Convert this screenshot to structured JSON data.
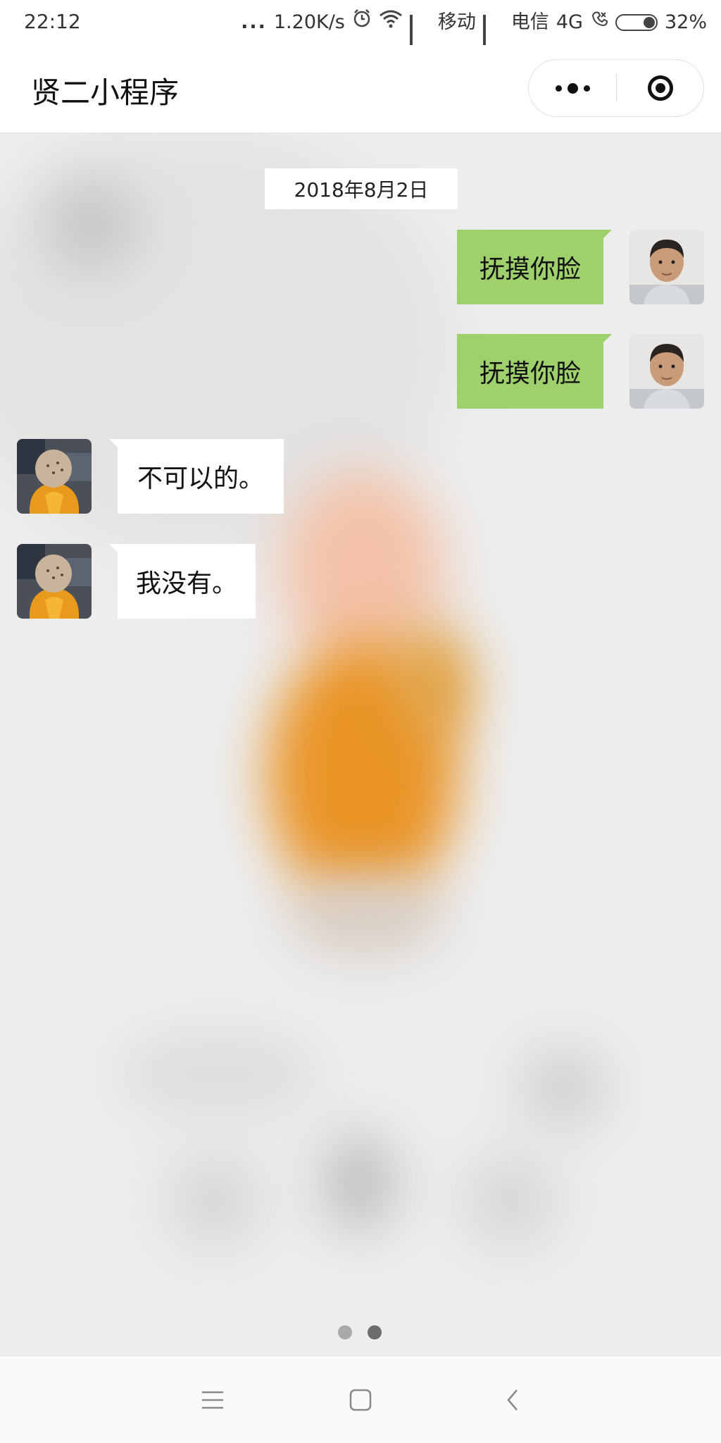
{
  "status_bar": {
    "time": "22:12",
    "more_dots": "...",
    "speed": "1.20K/s",
    "carrier1": "移动",
    "carrier2": "电信",
    "network": "4G",
    "battery": "32%"
  },
  "nav": {
    "title": "贤二小程序"
  },
  "chat": {
    "date": "2018年8月2日",
    "messages": [
      {
        "side": "right",
        "text": "抚摸你脸"
      },
      {
        "side": "right",
        "text": "抚摸你脸"
      },
      {
        "side": "left",
        "text": "不可以的。"
      },
      {
        "side": "left",
        "text": "我没有。"
      }
    ]
  },
  "pager": {
    "count": 2,
    "active": 1
  },
  "colors": {
    "bubble_user": "#9ed06c",
    "bubble_bot": "#ffffff",
    "chat_bg": "#ededed"
  },
  "icons": {
    "more": "more-dots-icon",
    "close": "target-icon",
    "menu": "menu-icon",
    "home": "home-icon",
    "back": "back-icon"
  }
}
